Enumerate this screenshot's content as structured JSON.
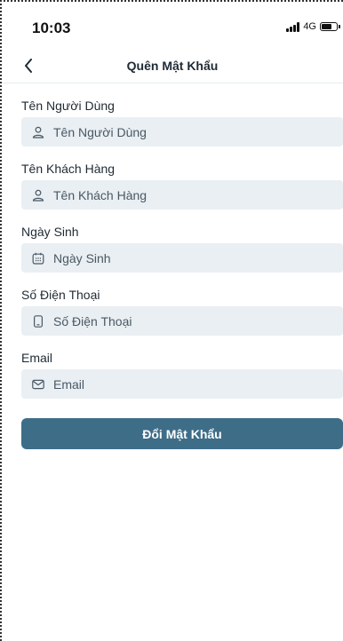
{
  "status_bar": {
    "time": "10:03",
    "network": "4G"
  },
  "nav": {
    "title": "Quên Mật Khẩu"
  },
  "form": {
    "fields": [
      {
        "label": "Tên Người Dùng",
        "placeholder": "Tên Người Dùng",
        "value": "",
        "icon": "user-icon"
      },
      {
        "label": "Tên Khách Hàng",
        "placeholder": "Tên Khách Hàng",
        "value": "",
        "icon": "user-icon"
      },
      {
        "label": "Ngày Sinh",
        "placeholder": "Ngày Sinh",
        "value": "",
        "icon": "calendar-icon"
      },
      {
        "label": "Số Điện Thoại",
        "placeholder": "Số Điện Thoại",
        "value": "",
        "icon": "phone-icon"
      },
      {
        "label": "Email",
        "placeholder": "Email",
        "value": "",
        "icon": "mail-icon"
      }
    ],
    "submit_label": "Đổi Mật Khẩu"
  },
  "colors": {
    "primary": "#3e6d88",
    "input_background": "#e9eff2",
    "text": "#1f2a33"
  }
}
